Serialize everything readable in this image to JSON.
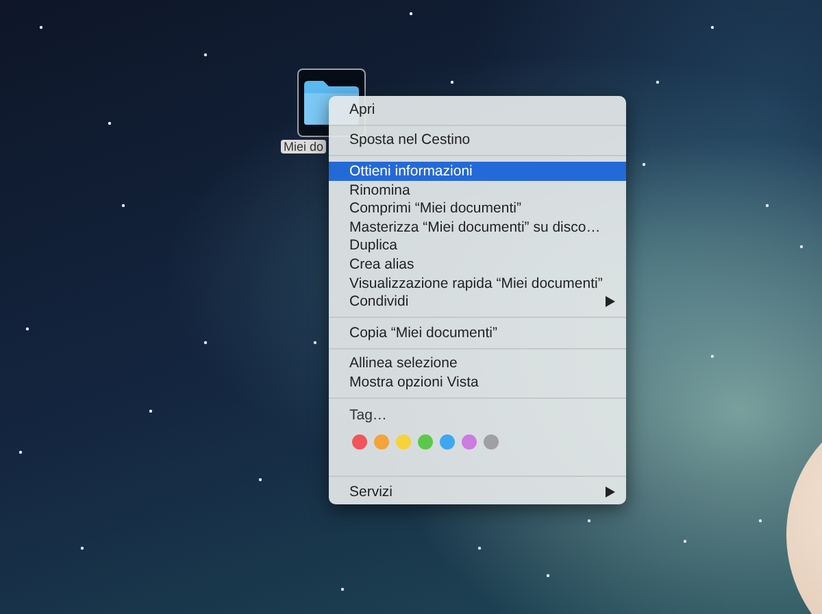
{
  "desktop_icon": {
    "label": "Miei do",
    "selected": true
  },
  "context_menu": {
    "sections": [
      {
        "kind": "items",
        "items": [
          {
            "label": "Apri",
            "selected": false,
            "submenu": false
          }
        ]
      },
      {
        "kind": "items",
        "items": [
          {
            "label": "Sposta nel Cestino",
            "selected": false,
            "submenu": false
          }
        ]
      },
      {
        "kind": "items",
        "items": [
          {
            "label": "Ottieni informazioni",
            "selected": true,
            "submenu": false
          },
          {
            "label": "Rinomina",
            "selected": false,
            "submenu": false
          },
          {
            "label": "Comprimi “Miei documenti”",
            "selected": false,
            "submenu": false
          },
          {
            "label": "Masterizza “Miei documenti” su disco…",
            "selected": false,
            "submenu": false
          },
          {
            "label": "Duplica",
            "selected": false,
            "submenu": false
          },
          {
            "label": "Crea alias",
            "selected": false,
            "submenu": false
          },
          {
            "label": "Visualizzazione rapida “Miei documenti”",
            "selected": false,
            "submenu": false
          },
          {
            "label": "Condividi",
            "selected": false,
            "submenu": true
          }
        ]
      },
      {
        "kind": "items",
        "items": [
          {
            "label": "Copia “Miei documenti”",
            "selected": false,
            "submenu": false
          }
        ]
      },
      {
        "kind": "items",
        "items": [
          {
            "label": "Allinea selezione",
            "selected": false,
            "submenu": false
          },
          {
            "label": "Mostra opzioni Vista",
            "selected": false,
            "submenu": false
          }
        ]
      },
      {
        "kind": "tags",
        "label": "Tag…",
        "colors": [
          {
            "color": "#f2545b"
          },
          {
            "color": "#f5a33b"
          },
          {
            "color": "#f5d33a"
          },
          {
            "color": "#5cc84a"
          },
          {
            "color": "#3fa7f0"
          },
          {
            "color": "#cc7be0"
          },
          {
            "color": "#a0a0a4"
          }
        ]
      },
      {
        "kind": "items",
        "items": [
          {
            "label": "Servizi",
            "selected": false,
            "submenu": true
          }
        ]
      }
    ]
  }
}
